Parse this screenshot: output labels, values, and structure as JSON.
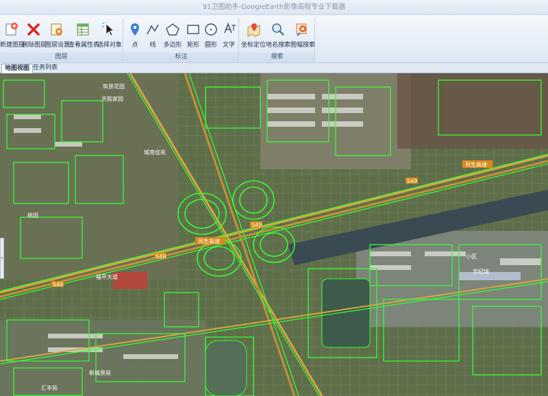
{
  "window": {
    "title": "91卫图助手-GoogleEarth影像高程专业下载器"
  },
  "ribbon": {
    "groups": [
      {
        "caption": "图层",
        "buttons": [
          "新建图层",
          "删除图层",
          "图层设置",
          "查看属性表",
          "选择对象"
        ]
      },
      {
        "caption": "标注",
        "buttons": [
          "点",
          "线",
          "多边形",
          "矩形",
          "圆形",
          "文字"
        ]
      },
      {
        "caption": "搜索",
        "buttons": [
          "坐标定位",
          "地名搜索",
          "图幅搜索"
        ]
      }
    ]
  },
  "tabs": [
    {
      "label": "地图视图",
      "active": true
    },
    {
      "label": "任务列表",
      "active": false
    }
  ],
  "map": {
    "road_labels": [
      "风生高速",
      "风生高速",
      "S49",
      "S49",
      "S49",
      "S49"
    ],
    "place_labels": [
      "筑景花园",
      "天韵家园",
      "城南佳苑",
      "福平大道",
      "桃园",
      "小区",
      "世纪城",
      "新城景苑",
      "汇丰苑"
    ],
    "colors": {
      "overlay": "#33ff33",
      "highway": "#d9a640",
      "terrain": "#5b6a46"
    }
  }
}
